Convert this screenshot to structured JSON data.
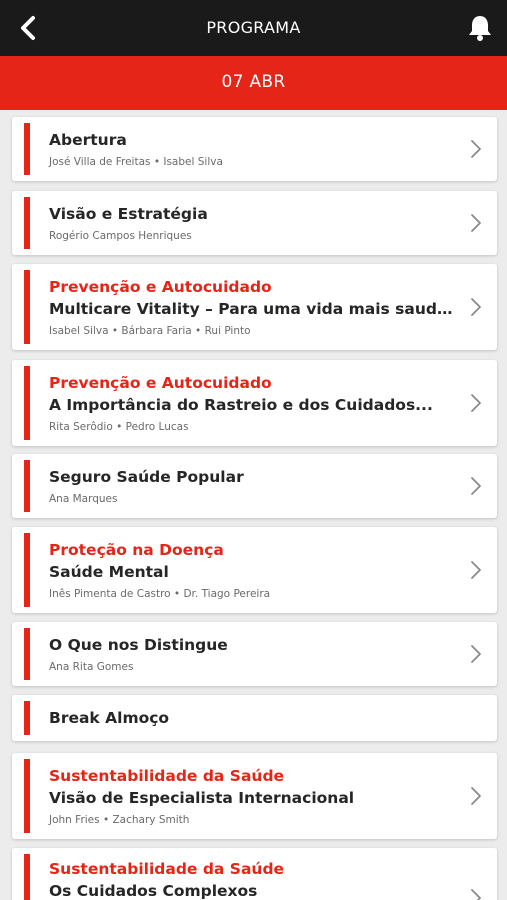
{
  "header": {
    "title": "PROGRAMA",
    "back_icon": "back-chevron-icon",
    "bell_icon": "bell-icon"
  },
  "date_bar": {
    "label": "07 ABR"
  },
  "colors": {
    "accent": "#e52517",
    "header_bg": "#1a1a1a",
    "background": "#ececec"
  },
  "sessions": [
    {
      "category": "",
      "title": "Abertura",
      "speakers": "José Villa de Freitas • Isabel Silva",
      "has_chevron": true
    },
    {
      "category": "",
      "title": "Visão e Estratégia",
      "speakers": "Rogério Campos Henriques",
      "has_chevron": true
    },
    {
      "category": "Prevenção e Autocuidado",
      "title": "Multicare Vitality – Para uma vida mais saudável",
      "speakers": "Isabel Silva • Bárbara Faria • Rui Pinto",
      "has_chevron": true
    },
    {
      "category": "Prevenção e Autocuidado",
      "title": "A Importância do Rastreio e dos Cuidados...",
      "speakers": "Rita Serôdio • Pedro Lucas",
      "has_chevron": true
    },
    {
      "category": "",
      "title": "Seguro Saúde Popular",
      "speakers": "Ana Marques",
      "has_chevron": true
    },
    {
      "category": "Proteção na Doença",
      "title": "Saúde Mental",
      "speakers": "Inês Pimenta de Castro • Dr. Tiago Pereira",
      "has_chevron": true
    },
    {
      "category": "",
      "title": "O Que nos Distingue",
      "speakers": "Ana Rita Gomes",
      "has_chevron": true
    },
    {
      "category": "",
      "title": "Break Almoço",
      "speakers": "",
      "has_chevron": false
    },
    {
      "category": "Sustentabilidade da Saúde",
      "title": "Visão de Especialista Internacional",
      "speakers": "John Fries • Zachary Smith",
      "has_chevron": true
    },
    {
      "category": "Sustentabilidade da Saúde",
      "title": "Os Cuidados Complexos",
      "speakers": "",
      "has_chevron": true
    }
  ]
}
